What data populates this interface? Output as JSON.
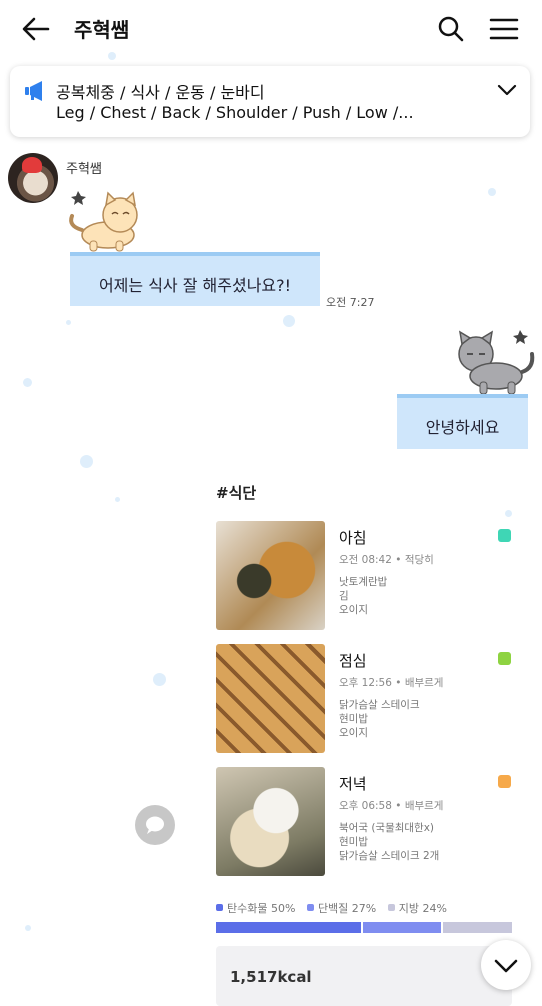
{
  "header": {
    "title": "주혁쌤",
    "back_icon": "arrow-left-icon",
    "search_icon": "search-icon",
    "menu_icon": "hamburger-menu-icon"
  },
  "notice": {
    "icon": "megaphone-icon",
    "icon_color": "#2f80ed",
    "line1": "공복체중 / 식사 / 운동 / 눈바디",
    "line2": "Leg / Chest / Back / Shoulder / Push / Low /..."
  },
  "chat": {
    "sender_name": "주혁쌤",
    "incoming_message": "어제는 식사 잘 해주셨나요?!",
    "incoming_time": "오전 7:27",
    "outgoing_message": "안녕하세요"
  },
  "diet": {
    "tag": "#식단",
    "meals": [
      {
        "name": "아침",
        "time": "오전 08:42",
        "portion": "적당히",
        "foods": [
          "낫토계란밥",
          "김",
          "오이지"
        ],
        "color": "#3fd6b5"
      },
      {
        "name": "점심",
        "time": "오후 12:56",
        "portion": "배부르게",
        "foods": [
          "닭가슴살 스테이크",
          "현미밥",
          "오이지"
        ],
        "color": "#8ed341"
      },
      {
        "name": "저녁",
        "time": "오후 06:58",
        "portion": "배부르게",
        "foods": [
          "북어국 (국물최대한x)",
          "현미밥",
          "닭가슴살 스테이크 2개"
        ],
        "color": "#f6a94a"
      }
    ],
    "macros": [
      {
        "label": "탄수화물 50%",
        "value": 50,
        "color": "#5b6ee8"
      },
      {
        "label": "단백질 27%",
        "value": 27,
        "color": "#7f8df0"
      },
      {
        "label": "지방 24%",
        "value": 24,
        "color": "#c7c7dc"
      }
    ],
    "kcal": "1,517kcal"
  },
  "bullet": "•"
}
